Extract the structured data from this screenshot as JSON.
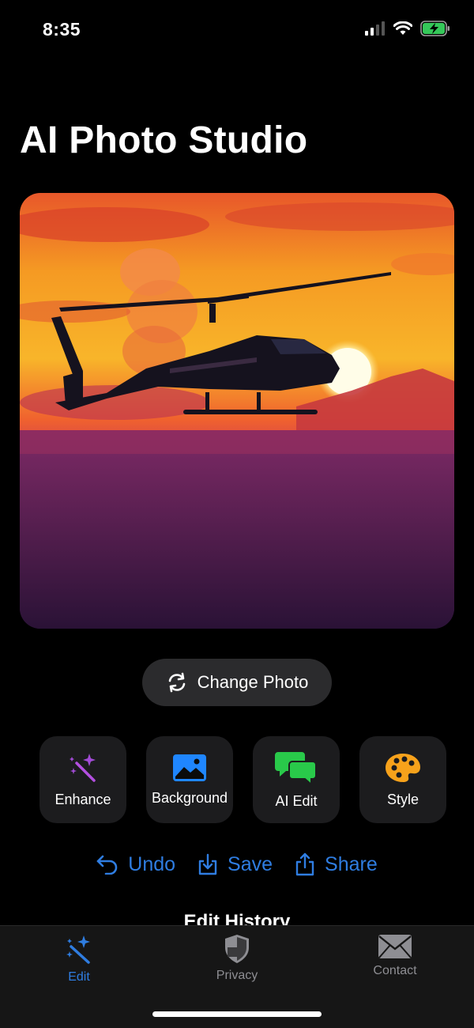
{
  "status": {
    "time": "8:35"
  },
  "page": {
    "title": "AI Photo Studio"
  },
  "photo": {
    "description_icon": "helicopter-sunset-photo"
  },
  "change_photo": {
    "label": "Change Photo",
    "icon": "refresh-icon"
  },
  "tools": [
    {
      "label": "Enhance",
      "icon": "magic-wand-icon"
    },
    {
      "label": "Background",
      "icon": "image-icon"
    },
    {
      "label": "AI Edit",
      "icon": "chat-bubbles-icon"
    },
    {
      "label": "Style",
      "icon": "palette-icon"
    }
  ],
  "actions": {
    "undo": "Undo",
    "save": "Save",
    "share": "Share"
  },
  "history": {
    "title": "Edit History"
  },
  "tabbar": {
    "edit": "Edit",
    "privacy": "Privacy",
    "contact": "Contact"
  },
  "colors": {
    "accent": "#2f7de1",
    "inactive": "#8e8e93"
  }
}
